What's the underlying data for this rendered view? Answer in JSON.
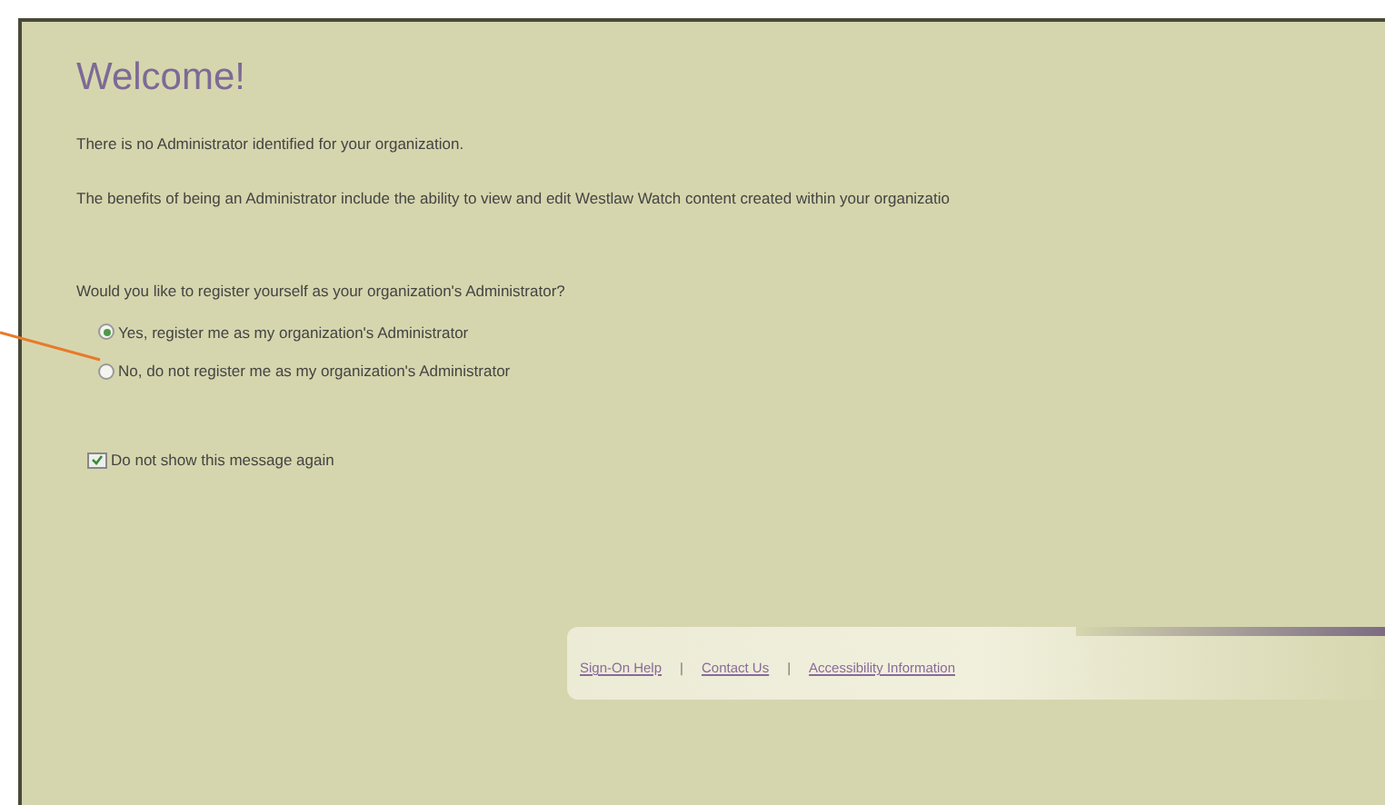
{
  "title": "Welcome!",
  "paragraphs": [
    "There is no Administrator identified for your organization.",
    "The benefits of being an Administrator include the ability to view and edit Westlaw Watch content created within your organizatio"
  ],
  "question": "Would you like to register yourself as your organization's Administrator?",
  "options": [
    {
      "label": "Yes, register me as my organization's Administrator",
      "selected": true
    },
    {
      "label": "No, do not register me as my organization's Administrator",
      "selected": false
    }
  ],
  "dont_show": {
    "label": "Do not show this message again",
    "checked": true
  },
  "footer_links": [
    {
      "kind": "link",
      "text": "Sign-On Help"
    },
    {
      "kind": "separator",
      "text": "|"
    },
    {
      "kind": "link",
      "text": "Contact Us"
    },
    {
      "kind": "separator",
      "text": "|"
    },
    {
      "kind": "link",
      "text": "Accessibility Information"
    }
  ]
}
